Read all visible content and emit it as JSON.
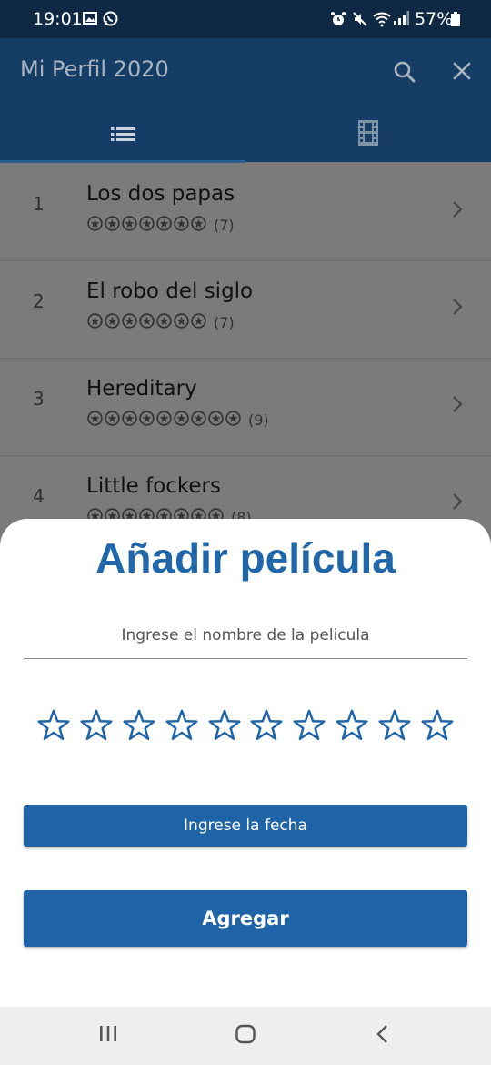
{
  "status_bar": {
    "time": "19:01",
    "battery": "57%",
    "left_icons": [
      "gallery-icon",
      "whatsapp-icon"
    ],
    "right_icons": [
      "alarm-icon",
      "mute-icon",
      "wifi-icon",
      "signal-icon",
      "battery-icon"
    ]
  },
  "app_bar": {
    "title": "Mi Perfil 2020",
    "actions": [
      "search-icon",
      "close-icon"
    ],
    "tabs": [
      {
        "icon": "list-icon",
        "selected": true
      },
      {
        "icon": "film-icon",
        "selected": false
      }
    ]
  },
  "movies": [
    {
      "rank": "1",
      "title": "Los dos papas",
      "stars": 7,
      "count": "(7)"
    },
    {
      "rank": "2",
      "title": "El robo del siglo",
      "stars": 7,
      "count": "(7)"
    },
    {
      "rank": "3",
      "title": "Hereditary",
      "stars": 9,
      "count": "(9)"
    },
    {
      "rank": "4",
      "title": "Little fockers",
      "stars": 8,
      "count": "(8)"
    }
  ],
  "sheet": {
    "title": "Añadir película",
    "name_placeholder": "Ingrese el nombre de la pelicula",
    "name_value": "",
    "rating": {
      "max": 10,
      "selected": 0
    },
    "date_button": "Ingrese la fecha",
    "add_button": "Agregar"
  },
  "colors": {
    "status_bar": "#0f2844",
    "app_bar": "#163d66",
    "accent": "#1f64a7",
    "title": "#1f67aa",
    "scrim_list": "#7b7b7b"
  },
  "nav_bar": [
    "recents-icon",
    "home-icon",
    "back-icon"
  ]
}
